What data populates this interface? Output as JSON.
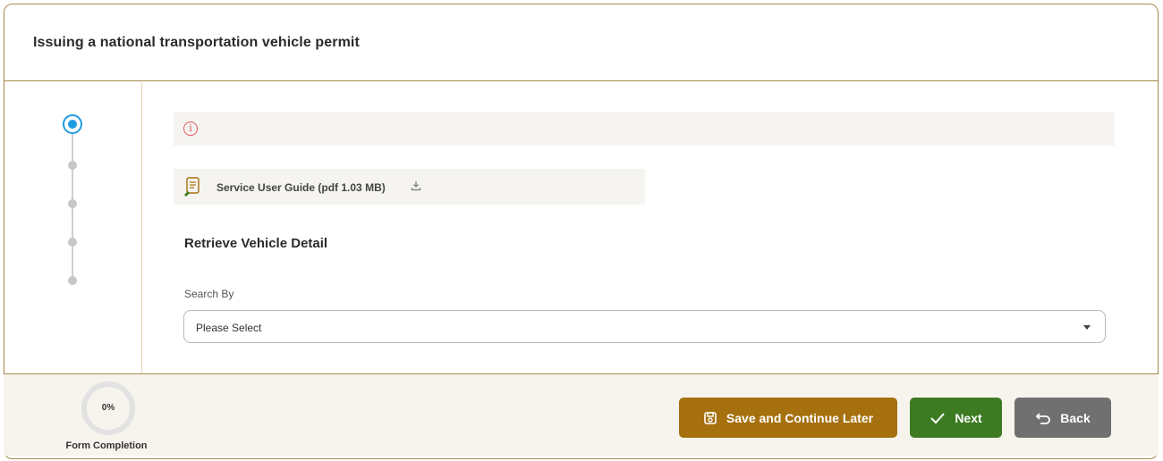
{
  "header": {
    "title": "Issuing a national transportation vehicle permit"
  },
  "stepper": {
    "steps": 5,
    "active_step": 1
  },
  "alert": {
    "icon": "info-icon",
    "text": ""
  },
  "guide": {
    "label": "Service User Guide (pdf 1.03 MB)",
    "icon": "document-icon",
    "action_icon": "download-icon"
  },
  "section": {
    "title": "Retrieve Vehicle Detail"
  },
  "search_by": {
    "label": "Search By",
    "value": "Please Select"
  },
  "footer": {
    "progress_percent": 0,
    "progress_text": "0%",
    "progress_label": "Form Completion",
    "save_label": "Save and Continue Later",
    "next_label": "Next",
    "back_label": "Back"
  },
  "colors": {
    "border": "#a88a4a",
    "step_active": "#1e9be0",
    "save_button": "#a6700e",
    "next_button": "#3d7b22",
    "back_button": "#707070",
    "alert_icon": "#e05a5a"
  }
}
